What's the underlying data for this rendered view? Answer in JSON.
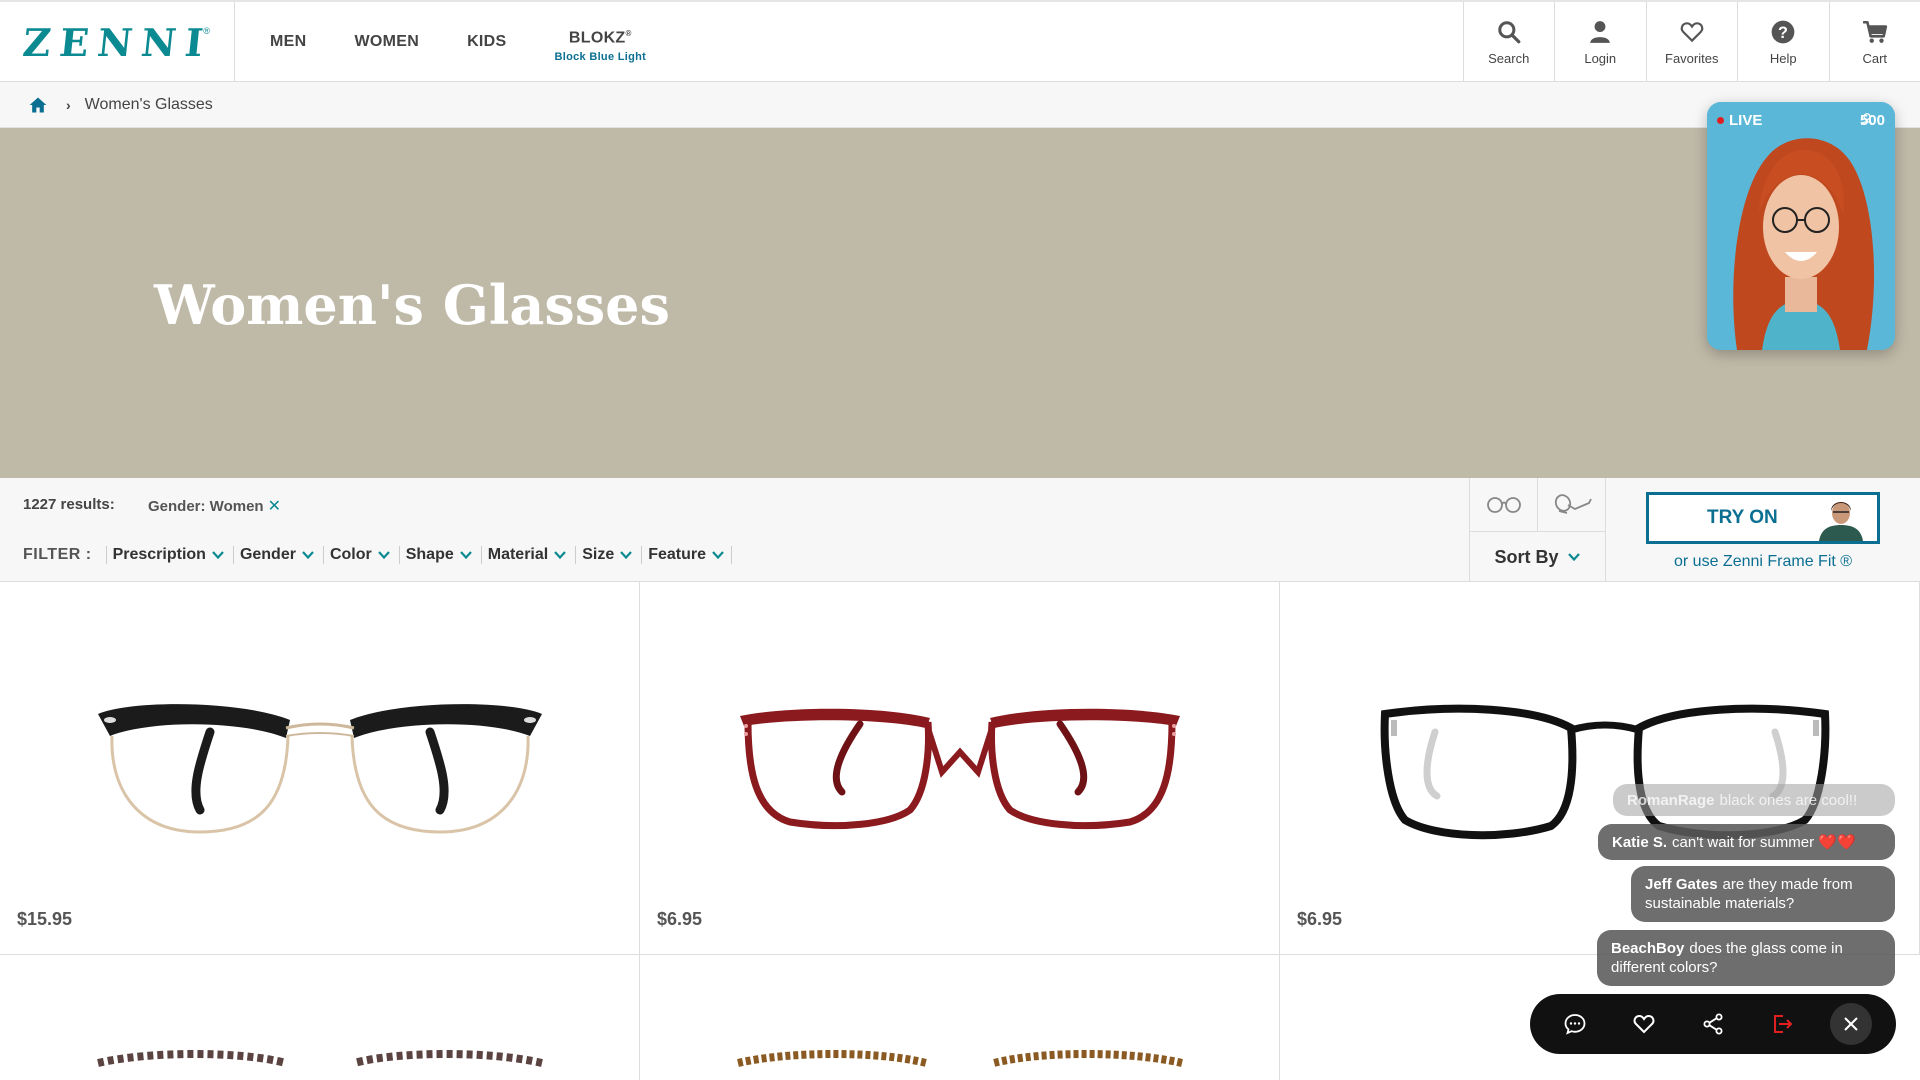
{
  "header": {
    "logo": "ZENNI",
    "nav": [
      "MEN",
      "WOMEN",
      "KIDS"
    ],
    "blokz": {
      "label": "BLOKZ",
      "mark": "®",
      "sub": "Block Blue Light"
    },
    "utilities": [
      {
        "label": "Search",
        "icon": "search-icon"
      },
      {
        "label": "Login",
        "icon": "user-icon"
      },
      {
        "label": "Favorites",
        "icon": "heart-icon"
      },
      {
        "label": "Help",
        "icon": "help-icon"
      },
      {
        "label": "Cart",
        "icon": "cart-icon"
      }
    ]
  },
  "breadcrumb": {
    "current": "Women's Glasses"
  },
  "hero": {
    "title": "Women's Glasses",
    "background": "#bfb9a8"
  },
  "live": {
    "badge": "LIVE",
    "viewers": "500"
  },
  "filters": {
    "results": "1227 results:",
    "active_chip": "Gender: Women",
    "label": "FILTER :",
    "items": [
      "Prescription",
      "Gender",
      "Color",
      "Shape",
      "Material",
      "Size",
      "Feature"
    ],
    "sort_by": "Sort By",
    "try_on": "TRY ON",
    "frame_fit": "or use Zenni Frame Fit ®"
  },
  "products": [
    {
      "price": "$15.95",
      "frame_color": "#1b1b1b"
    },
    {
      "price": "$6.95",
      "frame_color": "#8b1a1f"
    },
    {
      "price": "$6.95",
      "frame_color": "#111111"
    }
  ],
  "chat": [
    {
      "user": "RomanRage",
      "text": "black ones are cool!!"
    },
    {
      "user": "Katie S.",
      "text": "can't wait for summer ❤️❤️"
    },
    {
      "user": "Jeff Gates",
      "text": "are they made from",
      "text2": "sustainable materials?"
    },
    {
      "user": "BeachBoy",
      "text": "does the glass come in",
      "text2": "different colors?"
    }
  ],
  "colors": {
    "accent": "#0b8a92",
    "brand_blue": "#0b6f91",
    "live_red": "#e02020"
  }
}
